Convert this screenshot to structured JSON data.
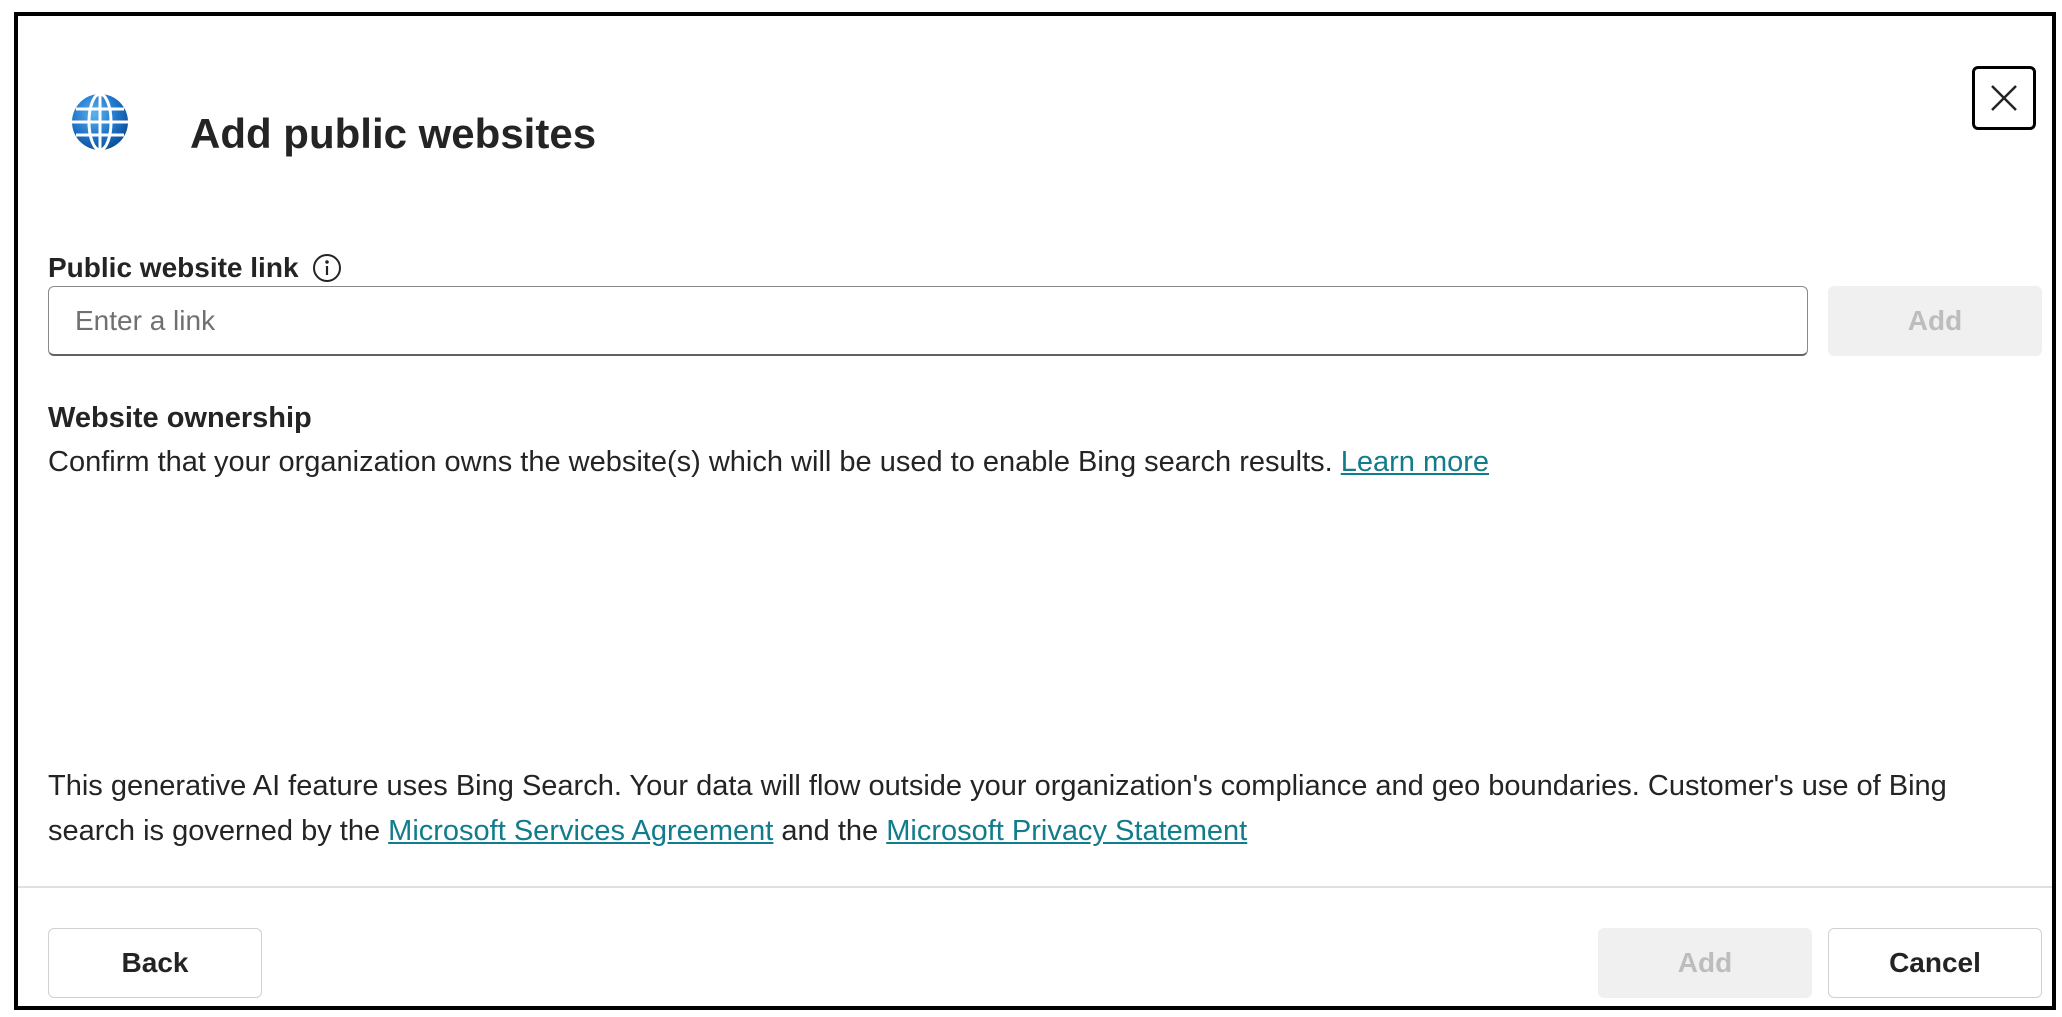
{
  "dialog": {
    "title": "Add public websites",
    "icon": "globe-icon",
    "close_icon": "close-icon"
  },
  "field": {
    "label": "Public website link",
    "info_icon": "info-icon",
    "placeholder": "Enter a link",
    "value": "",
    "add_label": "Add"
  },
  "ownership": {
    "heading": "Website ownership",
    "text": "Confirm that your organization owns the website(s) which will be used to enable Bing search results. ",
    "learn_more": "Learn more"
  },
  "disclaimer": {
    "text_before": "This generative AI feature uses Bing Search. Your data will flow outside your organization's compliance and geo boundaries. Customer's use of Bing search is governed by the ",
    "link1": "Microsoft Services Agreement",
    "text_middle": " and the ",
    "link2": "Microsoft Privacy Statement"
  },
  "footer": {
    "back_label": "Back",
    "add_label": "Add",
    "cancel_label": "Cancel"
  },
  "colors": {
    "link": "#117c8c",
    "disabled_bg": "#f0f0f0",
    "disabled_text": "#bdbdbd",
    "globe_blue": "#1e73c8"
  }
}
